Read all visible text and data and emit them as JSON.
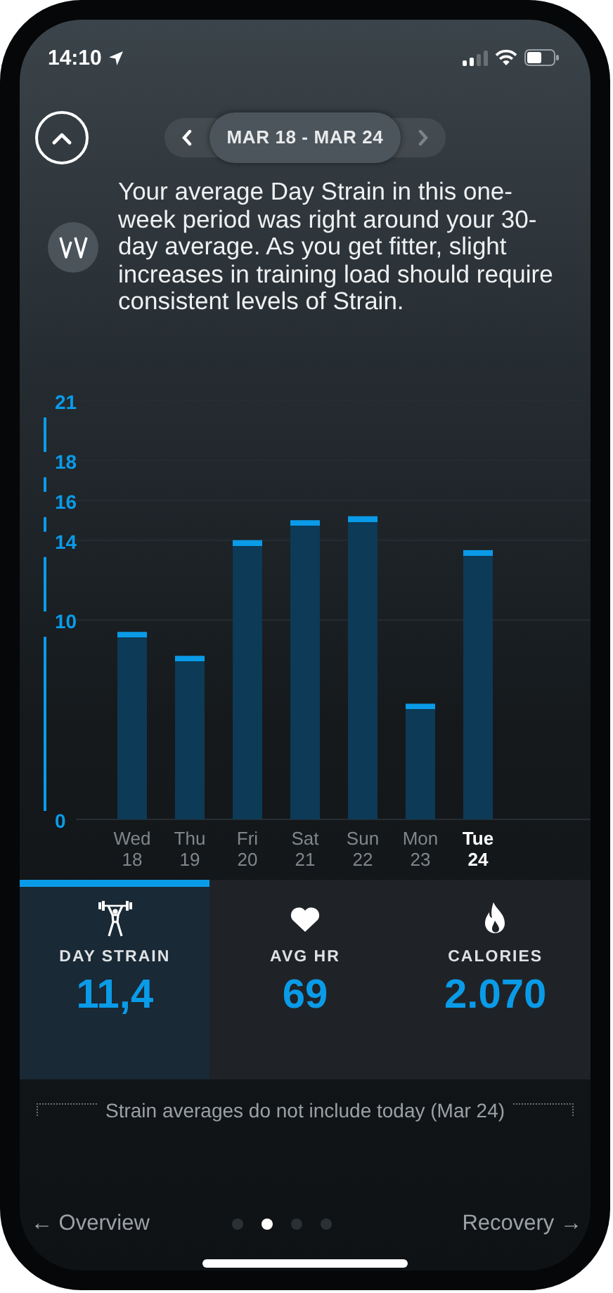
{
  "status_bar": {
    "time": "14:10"
  },
  "date_range": {
    "label": "MAR 18 - MAR 24"
  },
  "insight": "Your average Day Strain in this one-week period was right around your 30-day average. As you get fitter, slight increases in training load should require consistent levels of Strain.",
  "chart_data": {
    "type": "bar",
    "categories": [
      "Wed 18",
      "Thu 19",
      "Fri 20",
      "Sat 21",
      "Sun 22",
      "Mon 23",
      "Tue 24"
    ],
    "values": [
      9.4,
      8.2,
      14.0,
      15.0,
      15.2,
      5.8,
      13.5
    ],
    "grid": true,
    "ylim": [
      0,
      21
    ],
    "yticks": [
      0,
      10,
      14,
      16,
      18,
      21
    ]
  },
  "chart_days": [
    {
      "selected": false
    },
    {
      "selected": false
    },
    {
      "selected": false
    },
    {
      "selected": false
    },
    {
      "selected": false
    },
    {
      "selected": false
    },
    {
      "selected": true
    }
  ],
  "tabs": [
    {
      "kind": "strain",
      "label": "DAY STRAIN",
      "value": "11,4",
      "selected": true
    },
    {
      "kind": "heart",
      "label": "AVG HR",
      "value": "69",
      "selected": false
    },
    {
      "kind": "calories",
      "label": "CALORIES",
      "value": "2.070",
      "selected": false
    }
  ],
  "note": "Strain averages do not include today (Mar 24)",
  "footer": {
    "back": "← Overview",
    "next": "Recovery →",
    "pages": [
      {
        "selected": false
      },
      {
        "selected": true
      },
      {
        "selected": false
      },
      {
        "selected": false
      }
    ]
  }
}
